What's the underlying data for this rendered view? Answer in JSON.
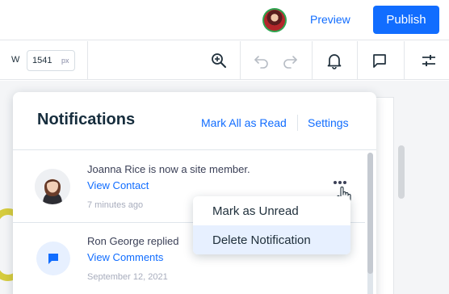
{
  "header": {
    "preview_label": "Preview",
    "publish_label": "Publish"
  },
  "toolbar": {
    "width_label": "W",
    "width_value": "1541",
    "width_unit": "px"
  },
  "notifications": {
    "title": "Notifications",
    "mark_all_label": "Mark All as Read",
    "settings_label": "Settings",
    "items": [
      {
        "text": "Joanna Rice is now a site member.",
        "link": "View Contact",
        "time": "7 minutes ago"
      },
      {
        "text": "Ron George replied",
        "link": "View Comments",
        "time": "September 12, 2021"
      }
    ]
  },
  "context_menu": {
    "items": [
      {
        "label": "Mark as Unread"
      },
      {
        "label": "Delete Notification"
      }
    ]
  },
  "colors": {
    "accent": "#116dff",
    "menu_hover": "#e7f0ff"
  }
}
